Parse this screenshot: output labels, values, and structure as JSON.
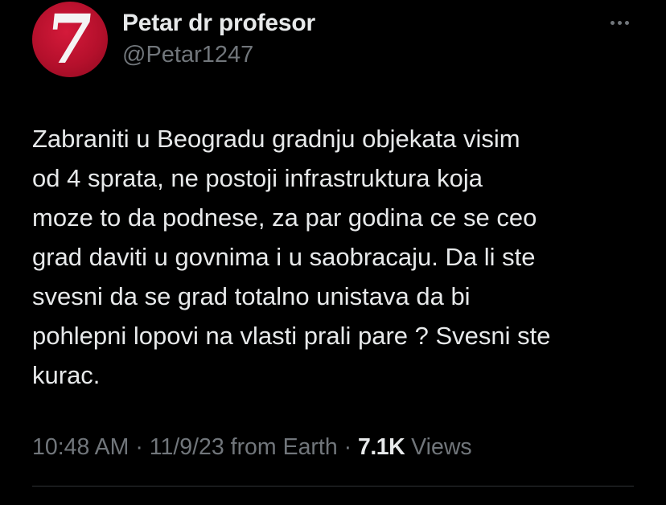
{
  "author": {
    "display_name": "Petar dr profesor",
    "handle": "@Petar1247",
    "avatar_glyph": "7",
    "avatar_color": "#c4142f"
  },
  "menu": {
    "more_icon": "more-horizontal-icon"
  },
  "tweet": {
    "text": "Zabraniti u Beogradu gradnju objekata visim\nod 4 sprata, ne postoji infrastruktura koja\nmoze to da podnese, za par godina ce se ceo\ngrad daviti u govnima i u saobracaju. Da li ste\nsvesni da se grad totalno unistava da bi\npohlepni lopovi na vlasti prali pare ? Svesni ste\nkurac."
  },
  "meta": {
    "time": "10:48 AM",
    "sep1": " · ",
    "date": "11/9/23",
    "source": " from Earth",
    "sep2": " · ",
    "views_count": "7.1K",
    "views_label": " Views"
  },
  "colors": {
    "background": "#000000",
    "primary_text": "#e7e9ea",
    "secondary_text": "#71767b",
    "divider": "#2f3336"
  }
}
